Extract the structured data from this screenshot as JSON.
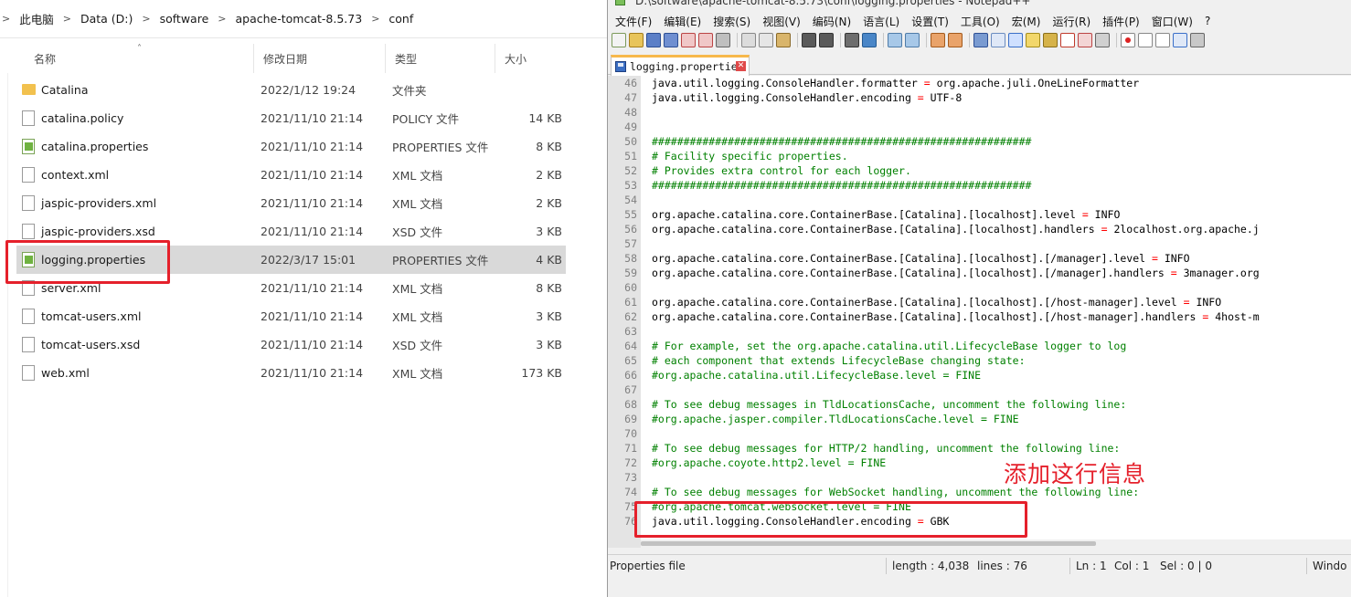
{
  "explorer": {
    "breadcrumb": [
      "此电脑",
      "Data (D:)",
      "software",
      "apache-tomcat-8.5.73",
      "conf"
    ],
    "columns": {
      "name": "名称",
      "date": "修改日期",
      "type": "类型",
      "size": "大小"
    },
    "files": [
      {
        "name": "Catalina",
        "date": "2022/1/12 19:24",
        "type": "文件夹",
        "size": "",
        "icon": "folder-icon",
        "selected": false
      },
      {
        "name": "catalina.policy",
        "date": "2021/11/10 21:14",
        "type": "POLICY 文件",
        "size": "14 KB",
        "icon": "file-icon",
        "selected": false
      },
      {
        "name": "catalina.properties",
        "date": "2021/11/10 21:14",
        "type": "PROPERTIES 文件",
        "size": "8 KB",
        "icon": "properties-file-icon",
        "selected": false
      },
      {
        "name": "context.xml",
        "date": "2021/11/10 21:14",
        "type": "XML 文档",
        "size": "2 KB",
        "icon": "file-icon",
        "selected": false
      },
      {
        "name": "jaspic-providers.xml",
        "date": "2021/11/10 21:14",
        "type": "XML 文档",
        "size": "2 KB",
        "icon": "file-icon",
        "selected": false
      },
      {
        "name": "jaspic-providers.xsd",
        "date": "2021/11/10 21:14",
        "type": "XSD 文件",
        "size": "3 KB",
        "icon": "file-icon",
        "selected": false
      },
      {
        "name": "logging.properties",
        "date": "2022/3/17 15:01",
        "type": "PROPERTIES 文件",
        "size": "4 KB",
        "icon": "properties-file-icon",
        "selected": true
      },
      {
        "name": "server.xml",
        "date": "2021/11/10 21:14",
        "type": "XML 文档",
        "size": "8 KB",
        "icon": "file-icon",
        "selected": false
      },
      {
        "name": "tomcat-users.xml",
        "date": "2021/11/10 21:14",
        "type": "XML 文档",
        "size": "3 KB",
        "icon": "file-icon",
        "selected": false
      },
      {
        "name": "tomcat-users.xsd",
        "date": "2021/11/10 21:14",
        "type": "XSD 文件",
        "size": "3 KB",
        "icon": "file-icon",
        "selected": false
      },
      {
        "name": "web.xml",
        "date": "2021/11/10 21:14",
        "type": "XML 文档",
        "size": "173 KB",
        "icon": "file-icon",
        "selected": false
      }
    ]
  },
  "npp": {
    "title": "D:\\software\\apache-tomcat-8.5.73\\conf\\logging.properties - Notepad++",
    "menu": [
      "文件(F)",
      "编辑(E)",
      "搜索(S)",
      "视图(V)",
      "编码(N)",
      "语言(L)",
      "设置(T)",
      "工具(O)",
      "宏(M)",
      "运行(R)",
      "插件(P)",
      "窗口(W)",
      "?"
    ],
    "tab_label": "logging.properties",
    "lines": [
      {
        "n": "46",
        "text": "java.util.logging.ConsoleHandler.formatter = org.apache.juli.OneLineFormatter",
        "kind": "kv"
      },
      {
        "n": "47",
        "text": "java.util.logging.ConsoleHandler.encoding = UTF-8",
        "kind": "kv"
      },
      {
        "n": "48",
        "text": "",
        "kind": "blank"
      },
      {
        "n": "49",
        "text": "",
        "kind": "blank"
      },
      {
        "n": "50",
        "text": "############################################################",
        "kind": "comment"
      },
      {
        "n": "51",
        "text": "# Facility specific properties.",
        "kind": "comment"
      },
      {
        "n": "52",
        "text": "# Provides extra control for each logger.",
        "kind": "comment"
      },
      {
        "n": "53",
        "text": "############################################################",
        "kind": "comment"
      },
      {
        "n": "54",
        "text": "",
        "kind": "blank"
      },
      {
        "n": "55",
        "text": "org.apache.catalina.core.ContainerBase.[Catalina].[localhost].level = INFO",
        "kind": "kv"
      },
      {
        "n": "56",
        "text": "org.apache.catalina.core.ContainerBase.[Catalina].[localhost].handlers = 2localhost.org.apache.j",
        "kind": "kv"
      },
      {
        "n": "57",
        "text": "",
        "kind": "blank"
      },
      {
        "n": "58",
        "text": "org.apache.catalina.core.ContainerBase.[Catalina].[localhost].[/manager].level = INFO",
        "kind": "kv"
      },
      {
        "n": "59",
        "text": "org.apache.catalina.core.ContainerBase.[Catalina].[localhost].[/manager].handlers = 3manager.org",
        "kind": "kv"
      },
      {
        "n": "60",
        "text": "",
        "kind": "blank"
      },
      {
        "n": "61",
        "text": "org.apache.catalina.core.ContainerBase.[Catalina].[localhost].[/host-manager].level = INFO",
        "kind": "kv"
      },
      {
        "n": "62",
        "text": "org.apache.catalina.core.ContainerBase.[Catalina].[localhost].[/host-manager].handlers = 4host-m",
        "kind": "kv"
      },
      {
        "n": "63",
        "text": "",
        "kind": "blank"
      },
      {
        "n": "64",
        "text": "# For example, set the org.apache.catalina.util.LifecycleBase logger to log",
        "kind": "comment"
      },
      {
        "n": "65",
        "text": "# each component that extends LifecycleBase changing state:",
        "kind": "comment"
      },
      {
        "n": "66",
        "text": "#org.apache.catalina.util.LifecycleBase.level = FINE",
        "kind": "comment"
      },
      {
        "n": "67",
        "text": "",
        "kind": "blank"
      },
      {
        "n": "68",
        "text": "# To see debug messages in TldLocationsCache, uncomment the following line:",
        "kind": "comment"
      },
      {
        "n": "69",
        "text": "#org.apache.jasper.compiler.TldLocationsCache.level = FINE",
        "kind": "comment"
      },
      {
        "n": "70",
        "text": "",
        "kind": "blank"
      },
      {
        "n": "71",
        "text": "# To see debug messages for HTTP/2 handling, uncomment the following line:",
        "kind": "comment"
      },
      {
        "n": "72",
        "text": "#org.apache.coyote.http2.level = FINE",
        "kind": "comment"
      },
      {
        "n": "73",
        "text": "",
        "kind": "blank"
      },
      {
        "n": "74",
        "text": "# To see debug messages for WebSocket handling, uncomment the following line:",
        "kind": "comment"
      },
      {
        "n": "75",
        "text": "#org.apache.tomcat.websocket.level = FINE",
        "kind": "comment"
      },
      {
        "n": "76",
        "text": "java.util.logging.ConsoleHandler.encoding = GBK",
        "kind": "kv"
      }
    ],
    "status": {
      "file_type": "Properties file",
      "length": "length : 4,038",
      "lines": "lines : 76",
      "ln": "Ln : 1",
      "col": "Col : 1",
      "sel": "Sel : 0 | 0",
      "eol": "Windo"
    }
  },
  "annotation": {
    "text": "添加这行信息",
    "color": "#e5202b"
  },
  "colors": {
    "highlight": "#e5202b",
    "selection": "#d9d9d9",
    "comment": "#008000",
    "operator": "#ff0000",
    "tab_accent": "#f7b84b"
  }
}
